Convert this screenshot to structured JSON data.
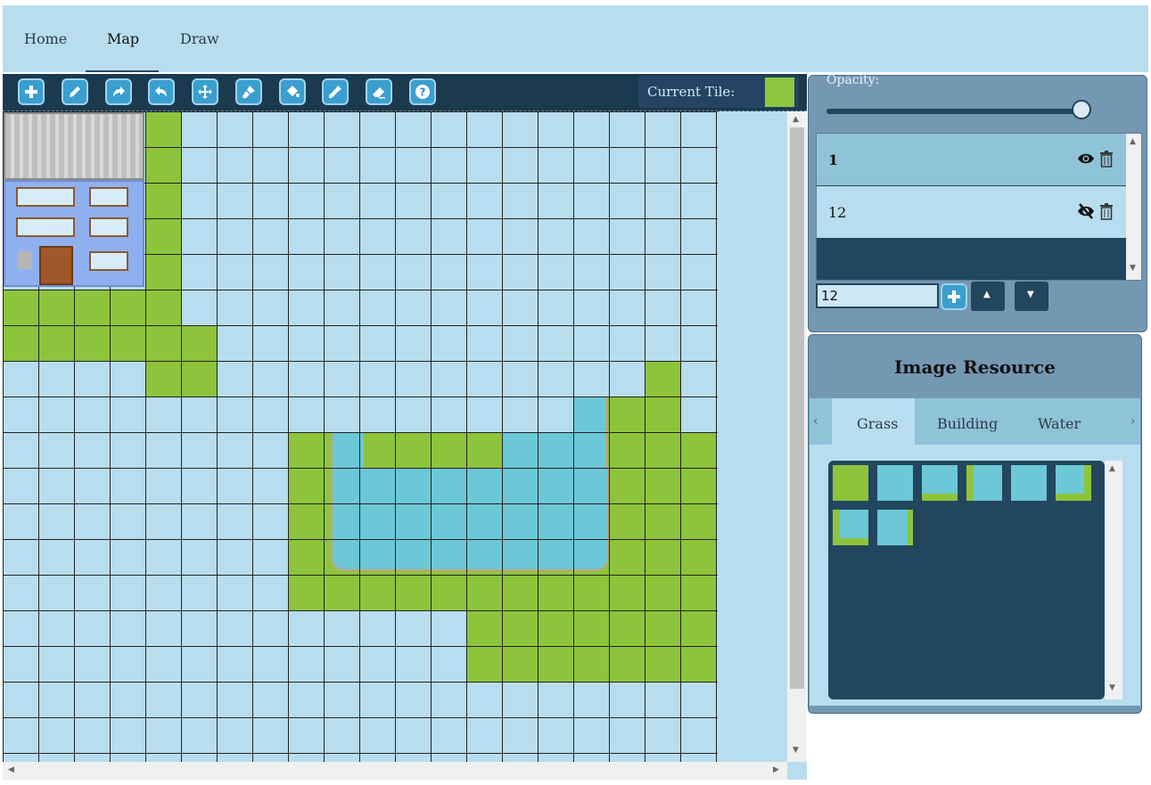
{
  "nav": {
    "tabs": [
      {
        "label": "Home"
      },
      {
        "label": "Map"
      },
      {
        "label": "Draw"
      }
    ],
    "active_tab": "Map"
  },
  "toolbar": {
    "tools": [
      "add-icon",
      "pencil-icon",
      "redo-icon",
      "undo-icon",
      "move-icon",
      "brush-icon",
      "fill-bucket-icon",
      "eyedropper-icon",
      "eraser-icon",
      "help-icon"
    ],
    "current_tile_label": "Current Tile:",
    "current_tile_color": "#8cc63f"
  },
  "layers": {
    "opacity_label": "Opacity:",
    "opacity_value": 1.0,
    "items": [
      {
        "name": "1",
        "visible": true,
        "selected": true
      },
      {
        "name": "12",
        "visible": false,
        "selected": false
      }
    ],
    "new_layer_value": "12"
  },
  "resource": {
    "title": "Image Resource",
    "tabs": [
      {
        "label": "Grass"
      },
      {
        "label": "Building"
      },
      {
        "label": "Water"
      }
    ],
    "active_tab": "Grass",
    "tile_count": 8
  },
  "colors": {
    "grass": "#8dc43c",
    "water": "#6cc8d6",
    "panel": "#7497b2",
    "dark": "#23465f",
    "light": "#b8ddee"
  }
}
